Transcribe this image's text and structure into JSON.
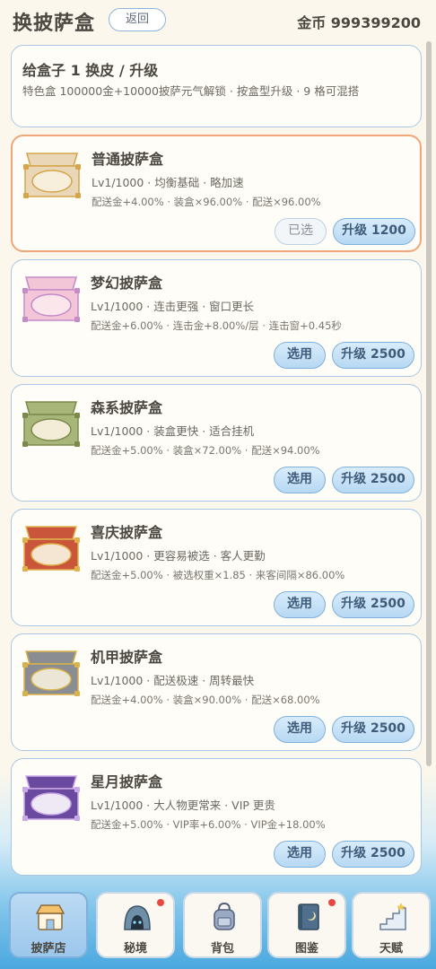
{
  "header": {
    "title": "换披萨盒",
    "back_label": "返回",
    "coins": "金币 999399200"
  },
  "info": {
    "title": "给盒子 1 换皮 / 升级",
    "desc": "特色盒 100000金+10000披萨元气解锁 · 按盒型升级 · 9 格可混搭"
  },
  "boxes": [
    {
      "name": "普通披萨盒",
      "level": "Lv1/1000 · 均衡基础 · 略加速",
      "stats": "配送金+4.00% · 装盒×96.00% · 配送×96.00%",
      "action": "已选",
      "upgrade": "升级 1200",
      "selected": true,
      "color": "#e9d7b8",
      "inner": "#f7efdc",
      "trim": "#d4a54a"
    },
    {
      "name": "梦幻披萨盒",
      "level": "Lv1/1000 · 连击更强 · 窗口更长",
      "stats": "配送金+6.00% · 连击金+8.00%/层 · 连击窗+0.45秒",
      "action": "选用",
      "upgrade": "升级 2500",
      "selected": false,
      "color": "#f2c6d6",
      "inner": "#fbe6ec",
      "trim": "#c58bc9"
    },
    {
      "name": "森系披萨盒",
      "level": "Lv1/1000 · 装盒更快 · 适合挂机",
      "stats": "配送金+5.00% · 装盒×72.00% · 配送×94.00%",
      "action": "选用",
      "upgrade": "升级 2500",
      "selected": false,
      "color": "#a9b67a",
      "inner": "#f3ecd6",
      "trim": "#7b8a4c"
    },
    {
      "name": "喜庆披萨盒",
      "level": "Lv1/1000 · 更容易被选 · 客人更勤",
      "stats": "配送金+5.00% · 被选权重×1.85 · 来客间隔×86.00%",
      "action": "选用",
      "upgrade": "升级 2500",
      "selected": false,
      "color": "#c9553a",
      "inner": "#f4e6d3",
      "trim": "#e0b04a"
    },
    {
      "name": "机甲披萨盒",
      "level": "Lv1/1000 · 配送极速 · 周转最快",
      "stats": "配送金+4.00% · 装盒×90.00% · 配送×68.00%",
      "action": "选用",
      "upgrade": "升级 2500",
      "selected": false,
      "color": "#8a8d92",
      "inner": "#ece6d6",
      "trim": "#d8b24a"
    },
    {
      "name": "星月披萨盒",
      "level": "Lv1/1000 · 大人物更常来 · VIP 更贵",
      "stats": "配送金+5.00% · VIP率+6.00% · VIP金+18.00%",
      "action": "选用",
      "upgrade": "升级 2500",
      "selected": false,
      "color": "#6a4a9e",
      "inner": "#efe8f5",
      "trim": "#c9a8e8"
    }
  ],
  "nav": [
    {
      "label": "披萨店",
      "icon": "shop-icon",
      "active": true,
      "badge": false
    },
    {
      "label": "秘境",
      "icon": "secret-realm-icon",
      "active": false,
      "badge": true
    },
    {
      "label": "背包",
      "icon": "backpack-icon",
      "active": false,
      "badge": false
    },
    {
      "label": "图鉴",
      "icon": "codex-book-icon",
      "active": false,
      "badge": true
    },
    {
      "label": "天赋",
      "icon": "talent-stairs-icon",
      "active": false,
      "badge": false
    }
  ]
}
